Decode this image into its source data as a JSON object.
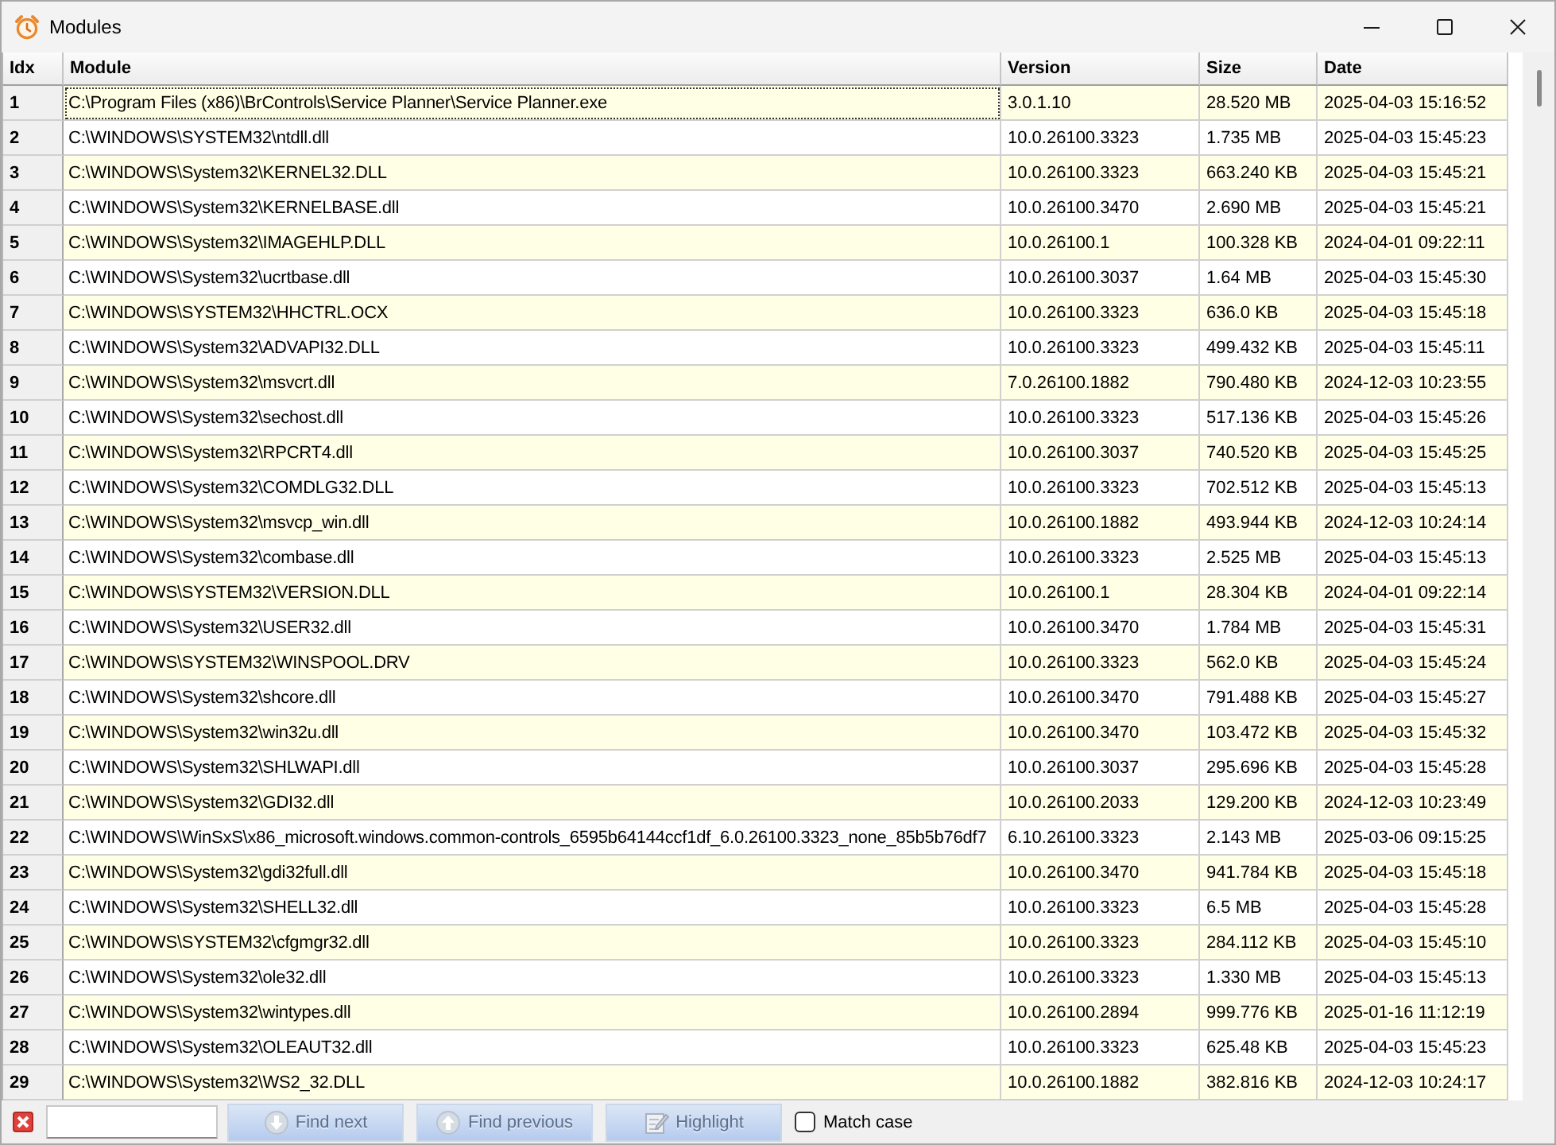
{
  "window": {
    "title": "Modules"
  },
  "table": {
    "columns": [
      "Idx",
      "Module",
      "Version",
      "Size",
      "Date"
    ],
    "rows": [
      {
        "cells": [
          "1",
          "C:\\Program Files (x86)\\BrControls\\Service Planner\\Service Planner.exe",
          "3.0.1.10",
          "28.520 MB",
          "2025-04-03 15:16:52"
        ],
        "focused": true
      },
      {
        "cells": [
          "2",
          "C:\\WINDOWS\\SYSTEM32\\ntdll.dll",
          "10.0.26100.3323",
          "1.735 MB",
          "2025-04-03 15:45:23"
        ],
        "focused": false
      },
      {
        "cells": [
          "3",
          "C:\\WINDOWS\\System32\\KERNEL32.DLL",
          "10.0.26100.3323",
          "663.240 KB",
          "2025-04-03 15:45:21"
        ],
        "focused": false
      },
      {
        "cells": [
          "4",
          "C:\\WINDOWS\\System32\\KERNELBASE.dll",
          "10.0.26100.3470",
          "2.690 MB",
          "2025-04-03 15:45:21"
        ],
        "focused": false
      },
      {
        "cells": [
          "5",
          "C:\\WINDOWS\\System32\\IMAGEHLP.DLL",
          "10.0.26100.1",
          "100.328 KB",
          "2024-04-01 09:22:11"
        ],
        "focused": false
      },
      {
        "cells": [
          "6",
          "C:\\WINDOWS\\System32\\ucrtbase.dll",
          "10.0.26100.3037",
          "1.64 MB",
          "2025-04-03 15:45:30"
        ],
        "focused": false
      },
      {
        "cells": [
          "7",
          "C:\\WINDOWS\\SYSTEM32\\HHCTRL.OCX",
          "10.0.26100.3323",
          "636.0 KB",
          "2025-04-03 15:45:18"
        ],
        "focused": false
      },
      {
        "cells": [
          "8",
          "C:\\WINDOWS\\System32\\ADVAPI32.DLL",
          "10.0.26100.3323",
          "499.432 KB",
          "2025-04-03 15:45:11"
        ],
        "focused": false
      },
      {
        "cells": [
          "9",
          "C:\\WINDOWS\\System32\\msvcrt.dll",
          "7.0.26100.1882",
          "790.480 KB",
          "2024-12-03 10:23:55"
        ],
        "focused": false
      },
      {
        "cells": [
          "10",
          "C:\\WINDOWS\\System32\\sechost.dll",
          "10.0.26100.3323",
          "517.136 KB",
          "2025-04-03 15:45:26"
        ],
        "focused": false
      },
      {
        "cells": [
          "11",
          "C:\\WINDOWS\\System32\\RPCRT4.dll",
          "10.0.26100.3037",
          "740.520 KB",
          "2025-04-03 15:45:25"
        ],
        "focused": false
      },
      {
        "cells": [
          "12",
          "C:\\WINDOWS\\System32\\COMDLG32.DLL",
          "10.0.26100.3323",
          "702.512 KB",
          "2025-04-03 15:45:13"
        ],
        "focused": false
      },
      {
        "cells": [
          "13",
          "C:\\WINDOWS\\System32\\msvcp_win.dll",
          "10.0.26100.1882",
          "493.944 KB",
          "2024-12-03 10:24:14"
        ],
        "focused": false
      },
      {
        "cells": [
          "14",
          "C:\\WINDOWS\\System32\\combase.dll",
          "10.0.26100.3323",
          "2.525 MB",
          "2025-04-03 15:45:13"
        ],
        "focused": false
      },
      {
        "cells": [
          "15",
          "C:\\WINDOWS\\SYSTEM32\\VERSION.DLL",
          "10.0.26100.1",
          "28.304 KB",
          "2024-04-01 09:22:14"
        ],
        "focused": false
      },
      {
        "cells": [
          "16",
          "C:\\WINDOWS\\System32\\USER32.dll",
          "10.0.26100.3470",
          "1.784 MB",
          "2025-04-03 15:45:31"
        ],
        "focused": false
      },
      {
        "cells": [
          "17",
          "C:\\WINDOWS\\SYSTEM32\\WINSPOOL.DRV",
          "10.0.26100.3323",
          "562.0 KB",
          "2025-04-03 15:45:24"
        ],
        "focused": false
      },
      {
        "cells": [
          "18",
          "C:\\WINDOWS\\System32\\shcore.dll",
          "10.0.26100.3470",
          "791.488 KB",
          "2025-04-03 15:45:27"
        ],
        "focused": false
      },
      {
        "cells": [
          "19",
          "C:\\WINDOWS\\System32\\win32u.dll",
          "10.0.26100.3470",
          "103.472 KB",
          "2025-04-03 15:45:32"
        ],
        "focused": false
      },
      {
        "cells": [
          "20",
          "C:\\WINDOWS\\System32\\SHLWAPI.dll",
          "10.0.26100.3037",
          "295.696 KB",
          "2025-04-03 15:45:28"
        ],
        "focused": false
      },
      {
        "cells": [
          "21",
          "C:\\WINDOWS\\System32\\GDI32.dll",
          "10.0.26100.2033",
          "129.200 KB",
          "2024-12-03 10:23:49"
        ],
        "focused": false
      },
      {
        "cells": [
          "22",
          "C:\\WINDOWS\\WinSxS\\x86_microsoft.windows.common-controls_6595b64144ccf1df_6.0.26100.3323_none_85b5b76df7",
          "6.10.26100.3323",
          "2.143 MB",
          "2025-03-06 09:15:25"
        ],
        "focused": false
      },
      {
        "cells": [
          "23",
          "C:\\WINDOWS\\System32\\gdi32full.dll",
          "10.0.26100.3470",
          "941.784 KB",
          "2025-04-03 15:45:18"
        ],
        "focused": false
      },
      {
        "cells": [
          "24",
          "C:\\WINDOWS\\System32\\SHELL32.dll",
          "10.0.26100.3323",
          "6.5 MB",
          "2025-04-03 15:45:28"
        ],
        "focused": false
      },
      {
        "cells": [
          "25",
          "C:\\WINDOWS\\SYSTEM32\\cfgmgr32.dll",
          "10.0.26100.3323",
          "284.112 KB",
          "2025-04-03 15:45:10"
        ],
        "focused": false
      },
      {
        "cells": [
          "26",
          "C:\\WINDOWS\\System32\\ole32.dll",
          "10.0.26100.3323",
          "1.330 MB",
          "2025-04-03 15:45:13"
        ],
        "focused": false
      },
      {
        "cells": [
          "27",
          "C:\\WINDOWS\\System32\\wintypes.dll",
          "10.0.26100.2894",
          "999.776 KB",
          "2025-01-16 11:12:19"
        ],
        "focused": false
      },
      {
        "cells": [
          "28",
          "C:\\WINDOWS\\System32\\OLEAUT32.dll",
          "10.0.26100.3323",
          "625.48 KB",
          "2025-04-03 15:45:23"
        ],
        "focused": false
      },
      {
        "cells": [
          "29",
          "C:\\WINDOWS\\System32\\WS2_32.DLL",
          "10.0.26100.1882",
          "382.816 KB",
          "2024-12-03 10:24:17"
        ],
        "focused": false
      }
    ]
  },
  "search_bar": {
    "buttons": [
      {
        "kind": "next",
        "label": "Find next",
        "disabled": true
      },
      {
        "kind": "previous",
        "label": "Find previous",
        "disabled": true
      },
      {
        "kind": "highlight",
        "label": "Highlight",
        "disabled": true
      }
    ],
    "match_case": {
      "label": "Match case",
      "checked": false
    }
  }
}
